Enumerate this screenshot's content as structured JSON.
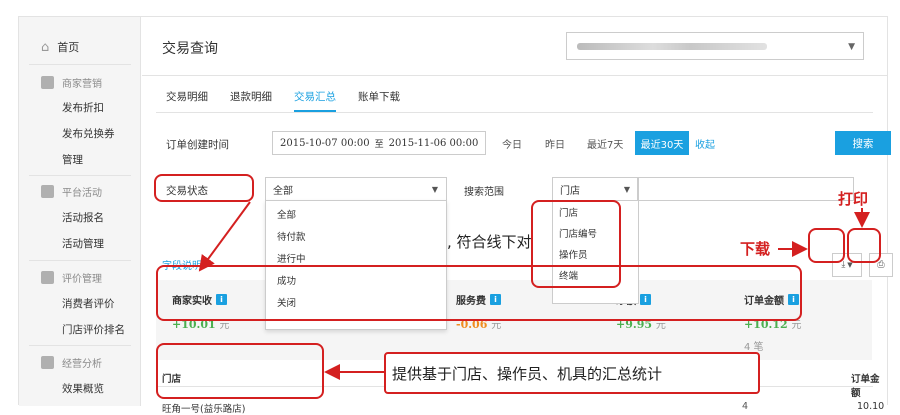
{
  "sidebar": {
    "home": "首页",
    "groups": [
      {
        "title": "商家营销",
        "items": [
          "发布折扣",
          "发布兑换券",
          "管理"
        ]
      },
      {
        "title": "平台活动",
        "items": [
          "活动报名",
          "活动管理"
        ]
      },
      {
        "title": "评价管理",
        "items": [
          "消费者评价",
          "门店评价排名"
        ]
      },
      {
        "title": "经营分析",
        "items": [
          "效果概览"
        ]
      }
    ]
  },
  "header": {
    "title": "交易查询"
  },
  "tabs": [
    "交易明细",
    "退款明细",
    "交易汇总",
    "账单下载"
  ],
  "filters": {
    "created_time_label": "订单创建时间",
    "date_start": "2015-10-07 00:00",
    "date_sep": "至",
    "date_end": "2015-11-06 00:00",
    "quick_ranges": [
      "今日",
      "昨日",
      "最近7天",
      "最近30天"
    ],
    "collapse": "收起",
    "search_button": "搜索",
    "status_label": "交易状态",
    "status_value": "全部",
    "status_options": [
      "全部",
      "待付款",
      "进行中",
      "成功",
      "关闭"
    ],
    "range_label": "搜索范围",
    "range_value": "门店",
    "range_options": [
      "门店",
      "门店编号",
      "操作员",
      "终端"
    ]
  },
  "field_help": "字段说明",
  "summary": [
    {
      "label": "商家实收",
      "value": "+10.01",
      "unit": "元"
    },
    {
      "label": "服务费",
      "value": "-0.06",
      "unit": "元"
    },
    {
      "label": "净额",
      "value": "+9.95",
      "unit": "元"
    },
    {
      "label": "订单金额",
      "value": "+10.12",
      "unit": "元"
    }
  ],
  "order_count": "4 笔",
  "table": {
    "headers": [
      "门店",
      "订单金额"
    ],
    "rows": [
      {
        "store": "旺角一号(益乐路店)",
        "count": "4",
        "amount": "10.10"
      }
    ]
  },
  "annotations": {
    "tooltip_fragment": ", 符合线下对",
    "download": "下载",
    "print": "打印",
    "callout": "提供基于门店、操作员、机具的汇总统计"
  },
  "colors": {
    "accent": "#1aa0e0",
    "annotation": "#d42020",
    "positive": "#4caf50",
    "negative": "#f08c1e"
  }
}
